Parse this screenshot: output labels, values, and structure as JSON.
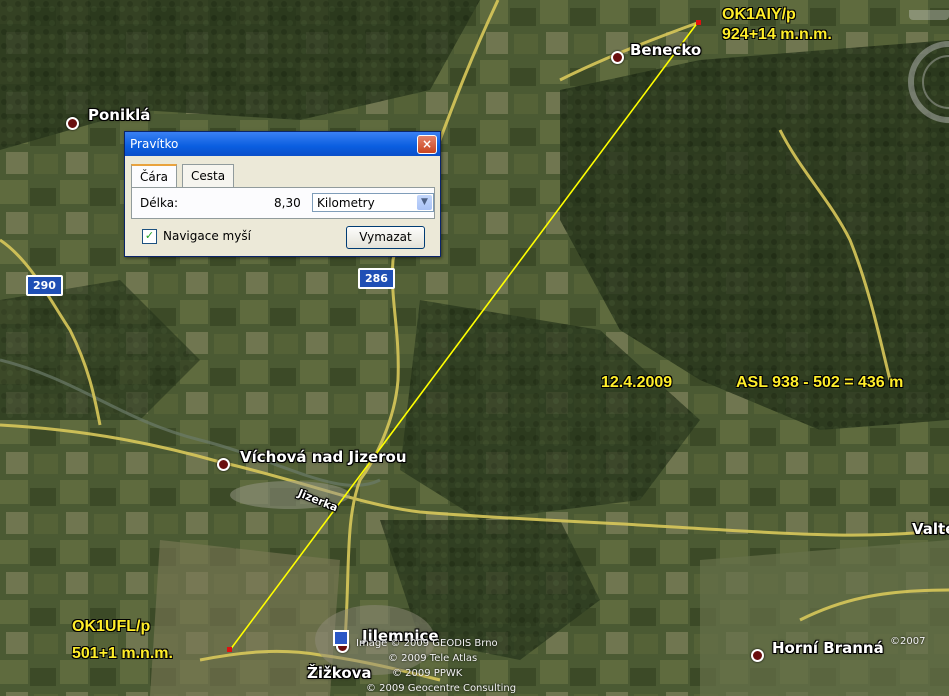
{
  "map": {
    "places": [
      {
        "name": "Benecko"
      },
      {
        "name": "Poniklá"
      },
      {
        "name": "Víchová nad Jizerou"
      },
      {
        "name": "Jilemnice"
      },
      {
        "name": "Horní Branná"
      },
      {
        "name": "Žižkova"
      },
      {
        "name": "Valteřice"
      }
    ],
    "roads": {
      "r290": "290",
      "r286": "286",
      "jizerka": "Jizerka"
    },
    "stations": {
      "top": {
        "call": "OK1AIY/p",
        "alt": "924+14 m.n.m."
      },
      "bottom": {
        "call": "OK1UFL/p",
        "alt": "501+1 m.n.m."
      }
    },
    "date": "12.4.2009",
    "asl": "ASL 938 - 502 = 436 m",
    "credits": [
      "Image © 2009 GEODIS Brno",
      "© 2009 Tele Atlas",
      "© 2009 PPWK",
      "© 2009 Geocentre Consulting"
    ],
    "copyright_corner": "©2007",
    "colors": {
      "line": "#ffff00",
      "labels": "#ffee2a",
      "road": "#d8c85a"
    }
  },
  "ruler": {
    "title": "Pravítko",
    "close_icon": "×",
    "tabs": [
      {
        "label": "Čára"
      },
      {
        "label": "Cesta"
      }
    ],
    "length_label": "Délka:",
    "length_value": "8,30",
    "unit": "Kilometry",
    "unit_arrow": "▼",
    "nav_label": "Navigace myší",
    "nav_checked": "✓",
    "clear_label": "Vymazat"
  }
}
